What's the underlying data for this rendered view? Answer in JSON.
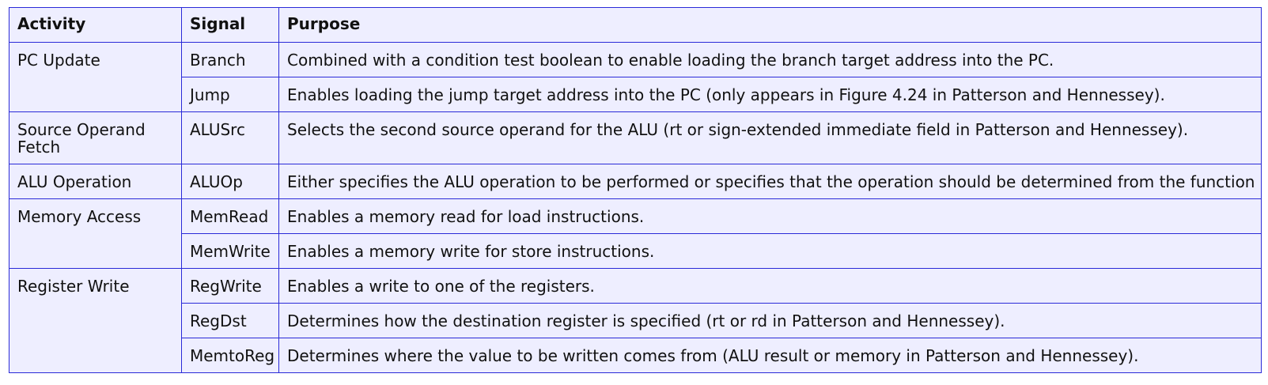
{
  "table": {
    "headers": [
      "Activity",
      "Signal",
      "Purpose"
    ],
    "groups": [
      {
        "activity": "PC Update",
        "rows": [
          {
            "signal": "Branch",
            "purpose": "Combined with a condition test boolean to enable loading the branch target address into the PC."
          },
          {
            "signal": "Jump",
            "purpose": "Enables loading the jump target address into the PC (only appears in Figure 4.24 in Patterson and Hennessey)."
          }
        ]
      },
      {
        "activity": "Source Operand Fetch",
        "rows": [
          {
            "signal": "ALUSrc",
            "purpose": "Selects the second source operand for the ALU (rt or sign-extended immediate field in Patterson and Hennessey)."
          }
        ]
      },
      {
        "activity": "ALU Operation",
        "rows": [
          {
            "signal": "ALUOp",
            "purpose": "Either specifies the ALU operation to be performed or specifies that the operation should be determined from the function bits."
          }
        ]
      },
      {
        "activity": "Memory Access",
        "rows": [
          {
            "signal": "MemRead",
            "purpose": "Enables a memory read for load instructions."
          },
          {
            "signal": "MemWrite",
            "purpose": "Enables a memory write for store instructions."
          }
        ]
      },
      {
        "activity": "Register Write",
        "rows": [
          {
            "signal": "RegWrite",
            "purpose": "Enables a write to one of the registers."
          },
          {
            "signal": "RegDst",
            "purpose": "Determines how the destination register is specified (rt or rd in Patterson and Hennessey)."
          },
          {
            "signal": "MemtoReg",
            "purpose": "Determines where the value to be written comes from (ALU result or memory in Patterson and Hennessey)."
          }
        ]
      }
    ]
  },
  "colors": {
    "border": "#2a2ad8",
    "cell_background": "#eeeeff",
    "text": "#111111"
  }
}
